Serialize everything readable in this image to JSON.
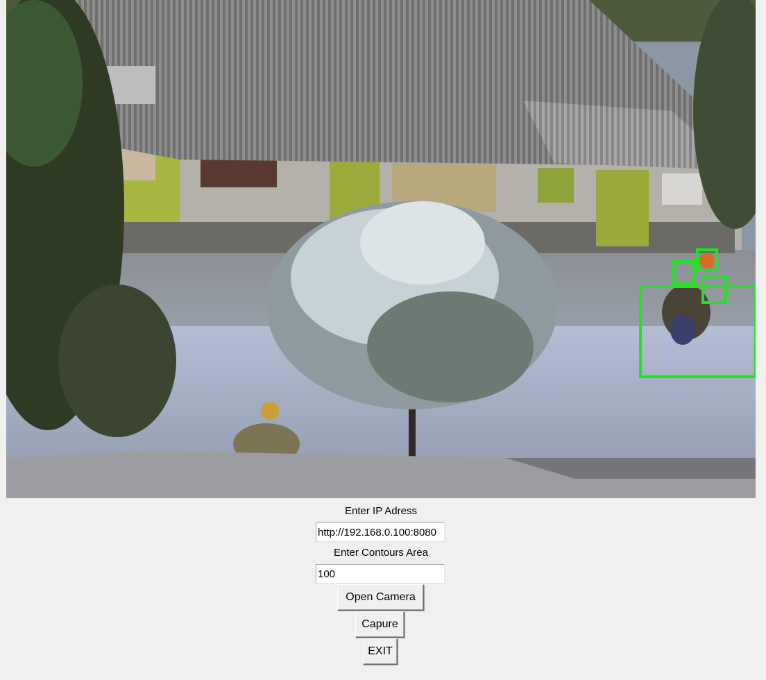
{
  "camera": {
    "detections": 4
  },
  "form": {
    "ip_label": "Enter IP Adress",
    "ip_value": "http://192.168.0.100:8080",
    "contour_label": "Enter Contours Area",
    "contour_value": "100"
  },
  "buttons": {
    "open_camera": "Open Camera",
    "capture": "Capure",
    "exit": "EXIT"
  },
  "colors": {
    "window_bg": "#f0f0f0",
    "detection_box": "#1ee61e"
  }
}
